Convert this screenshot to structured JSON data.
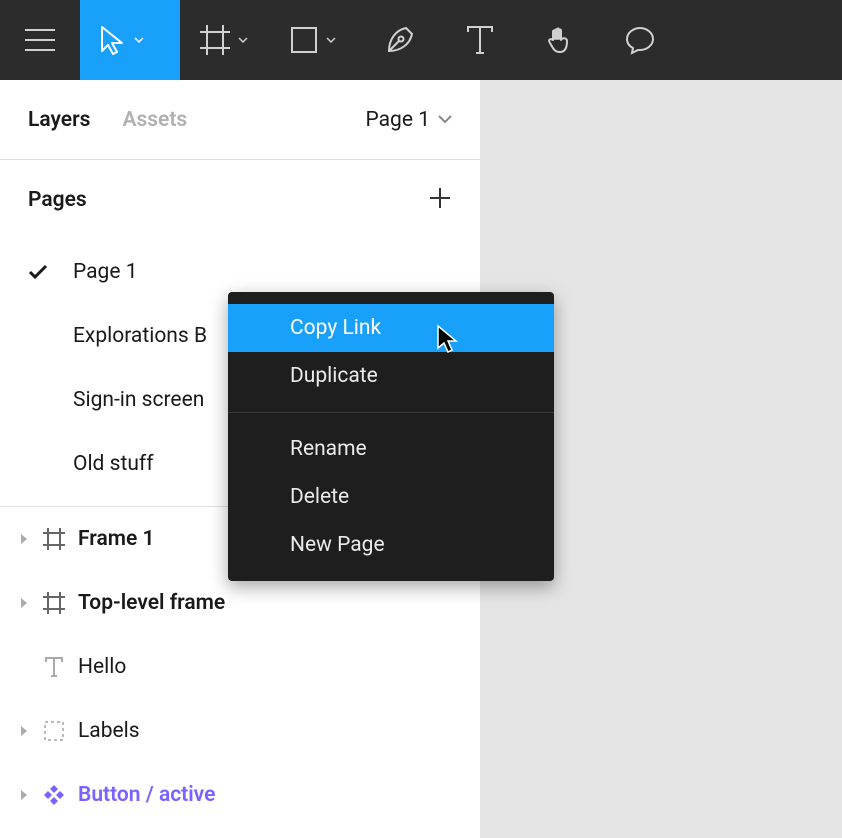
{
  "toolbar": {
    "tools": [
      "menu",
      "move",
      "frame",
      "shape",
      "pen",
      "text",
      "hand",
      "comment"
    ]
  },
  "panel": {
    "tabs": {
      "layers": "Layers",
      "assets": "Assets"
    },
    "current_page": "Page 1"
  },
  "pages": {
    "title": "Pages",
    "items": [
      {
        "label": "Page 1",
        "active": true
      },
      {
        "label": "Explorations B",
        "active": false
      },
      {
        "label": "Sign-in screen",
        "active": false
      },
      {
        "label": "Old stuff",
        "active": false
      }
    ]
  },
  "layers": [
    {
      "name": "Frame 1",
      "kind": "frame",
      "bold": true,
      "expand": true
    },
    {
      "name": "Top-level frame",
      "kind": "frame",
      "bold": true,
      "expand": true
    },
    {
      "name": "Hello",
      "kind": "text",
      "bold": false,
      "expand": false
    },
    {
      "name": "Labels",
      "kind": "group",
      "bold": false,
      "expand": true
    },
    {
      "name": "Button / active",
      "kind": "component",
      "bold": true,
      "expand": true,
      "purple": true
    }
  ],
  "context_menu": {
    "items_a": [
      "Copy Link",
      "Duplicate"
    ],
    "items_b": [
      "Rename",
      "Delete",
      "New Page"
    ],
    "highlighted": "Copy Link"
  }
}
